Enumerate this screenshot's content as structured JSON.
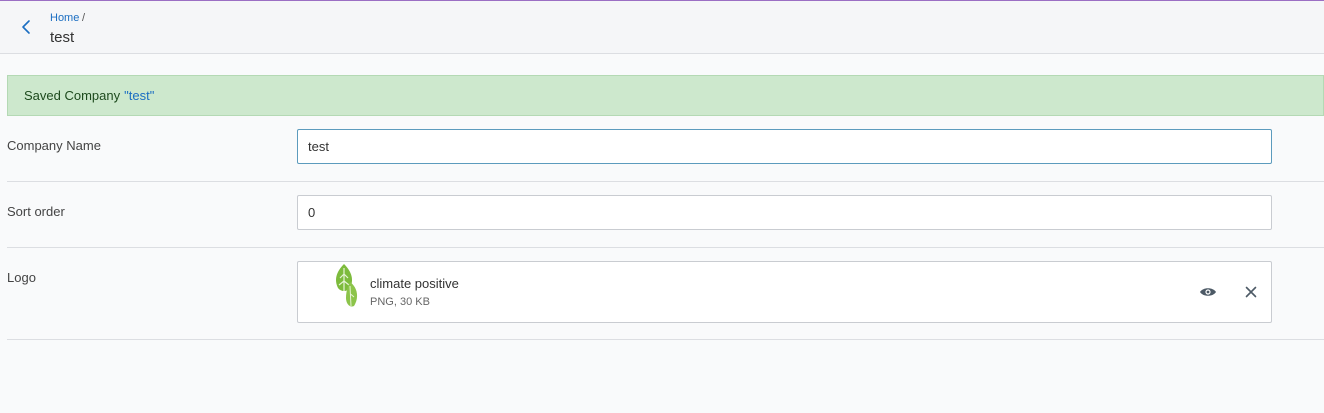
{
  "header": {
    "breadcrumb_home": "Home",
    "breadcrumb_separator": "/",
    "title": "test"
  },
  "alert": {
    "prefix": "Saved Company",
    "name": "\"test\""
  },
  "form": {
    "company_name": {
      "label": "Company Name",
      "value": "test"
    },
    "sort_order": {
      "label": "Sort order",
      "value": "0"
    },
    "logo": {
      "label": "Logo",
      "file_name": "climate positive",
      "file_meta": "PNG, 30 KB"
    }
  },
  "icons": {
    "back": "chevron-left-icon",
    "preview": "eye-icon",
    "remove": "close-icon"
  },
  "colors": {
    "accent": "#1b6ec2",
    "success_bg": "#cde8cd",
    "top_border": "#9b6fc4"
  }
}
